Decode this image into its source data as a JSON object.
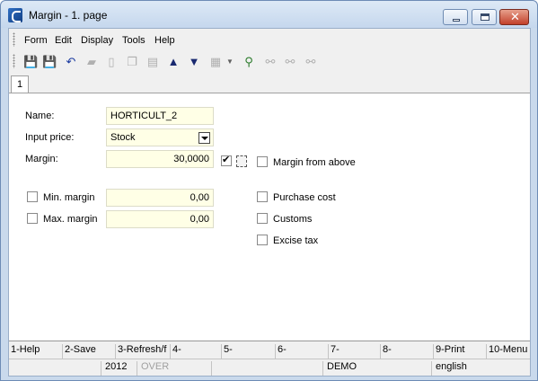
{
  "window": {
    "title": "Margin - 1. page",
    "close_glyph": "✕"
  },
  "menu": {
    "items": [
      "Form",
      "Edit",
      "Display",
      "Tools",
      "Help"
    ]
  },
  "toolbar": {
    "icons": [
      "save-icon",
      "save-as-icon",
      "undo-icon",
      "open-folder-icon",
      "new-document-icon",
      "copy-icon",
      "book-icon",
      "arrow-up-icon",
      "arrow-down-icon",
      "print-icon",
      "dropdown-arrow-icon",
      "find-filter-icon",
      "binoculars-icon",
      "binoculars-prev-icon",
      "binoculars-next-icon"
    ]
  },
  "tab": {
    "label": "1"
  },
  "form": {
    "name_label": "Name:",
    "name_value": "HORTICULT_2",
    "input_price_label": "Input price:",
    "input_price_value": "Stock",
    "margin_label": "Margin:",
    "margin_value": "30,0000",
    "margin_checked": true,
    "margin_from_above_label": "Margin from above",
    "min_margin_label": "Min. margin",
    "min_margin_value": "0,00",
    "max_margin_label": "Max. margin",
    "max_margin_value": "0,00",
    "purchase_cost_label": "Purchase cost",
    "customs_label": "Customs",
    "excise_tax_label": "Excise tax"
  },
  "function_keys": [
    "1-Help",
    "2-Save",
    "3-Refresh/f",
    "4-",
    "5-",
    "6-",
    "7-",
    "8-",
    "9-Print",
    "10-Menu"
  ],
  "status_bar": {
    "year": "2012",
    "mode": "OVER",
    "database": "DEMO",
    "language": "english"
  }
}
